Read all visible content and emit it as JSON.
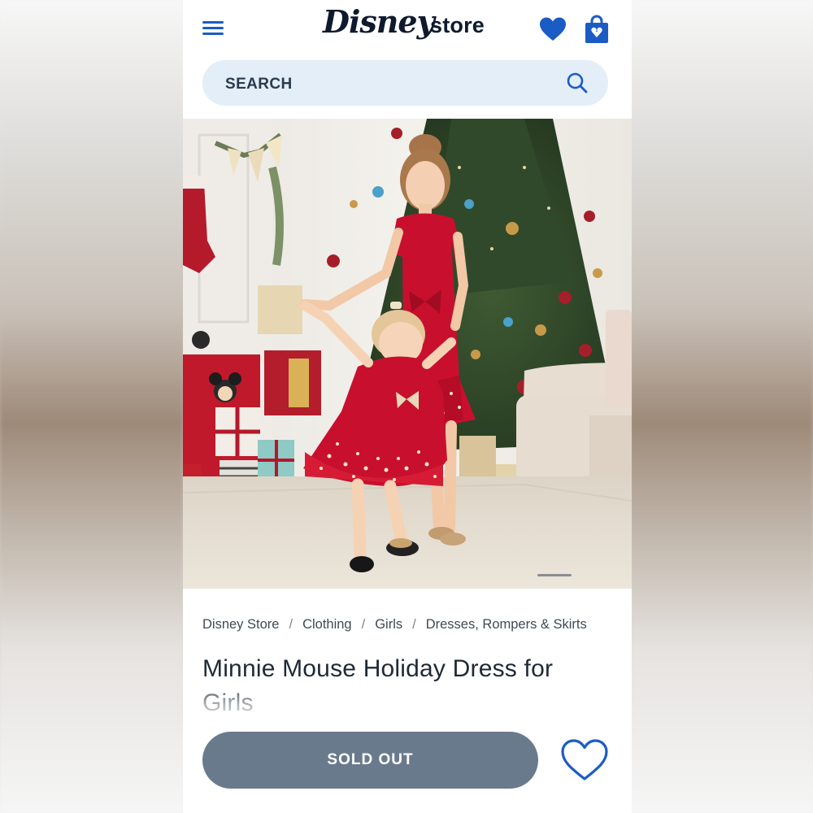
{
  "header": {
    "logo_script": "Disney",
    "logo_store": "store",
    "icons": {
      "menu": "hamburger-menu-icon",
      "wishlist": "heart-icon",
      "bag": "shopping-bag-icon"
    }
  },
  "search": {
    "label": "SEARCH",
    "icon": "search-icon"
  },
  "hero": {
    "alt": "Two girls in red holiday dresses in front of a Christmas tree",
    "carousel_active_index": 1
  },
  "breadcrumb": [
    {
      "label": "Disney Store"
    },
    {
      "label": "Clothing"
    },
    {
      "label": "Girls"
    },
    {
      "label": "Dresses, Rompers & Skirts"
    }
  ],
  "breadcrumb_separator": "/",
  "product": {
    "title": "Minnie Mouse Holiday Dress for Girls",
    "status_button": "SOLD OUT"
  },
  "colors": {
    "brand_blue": "#1b5cc4",
    "search_bg": "#e3eef8",
    "sold_out_bg": "#6a7a8d",
    "dress_red": "#c8102e"
  }
}
